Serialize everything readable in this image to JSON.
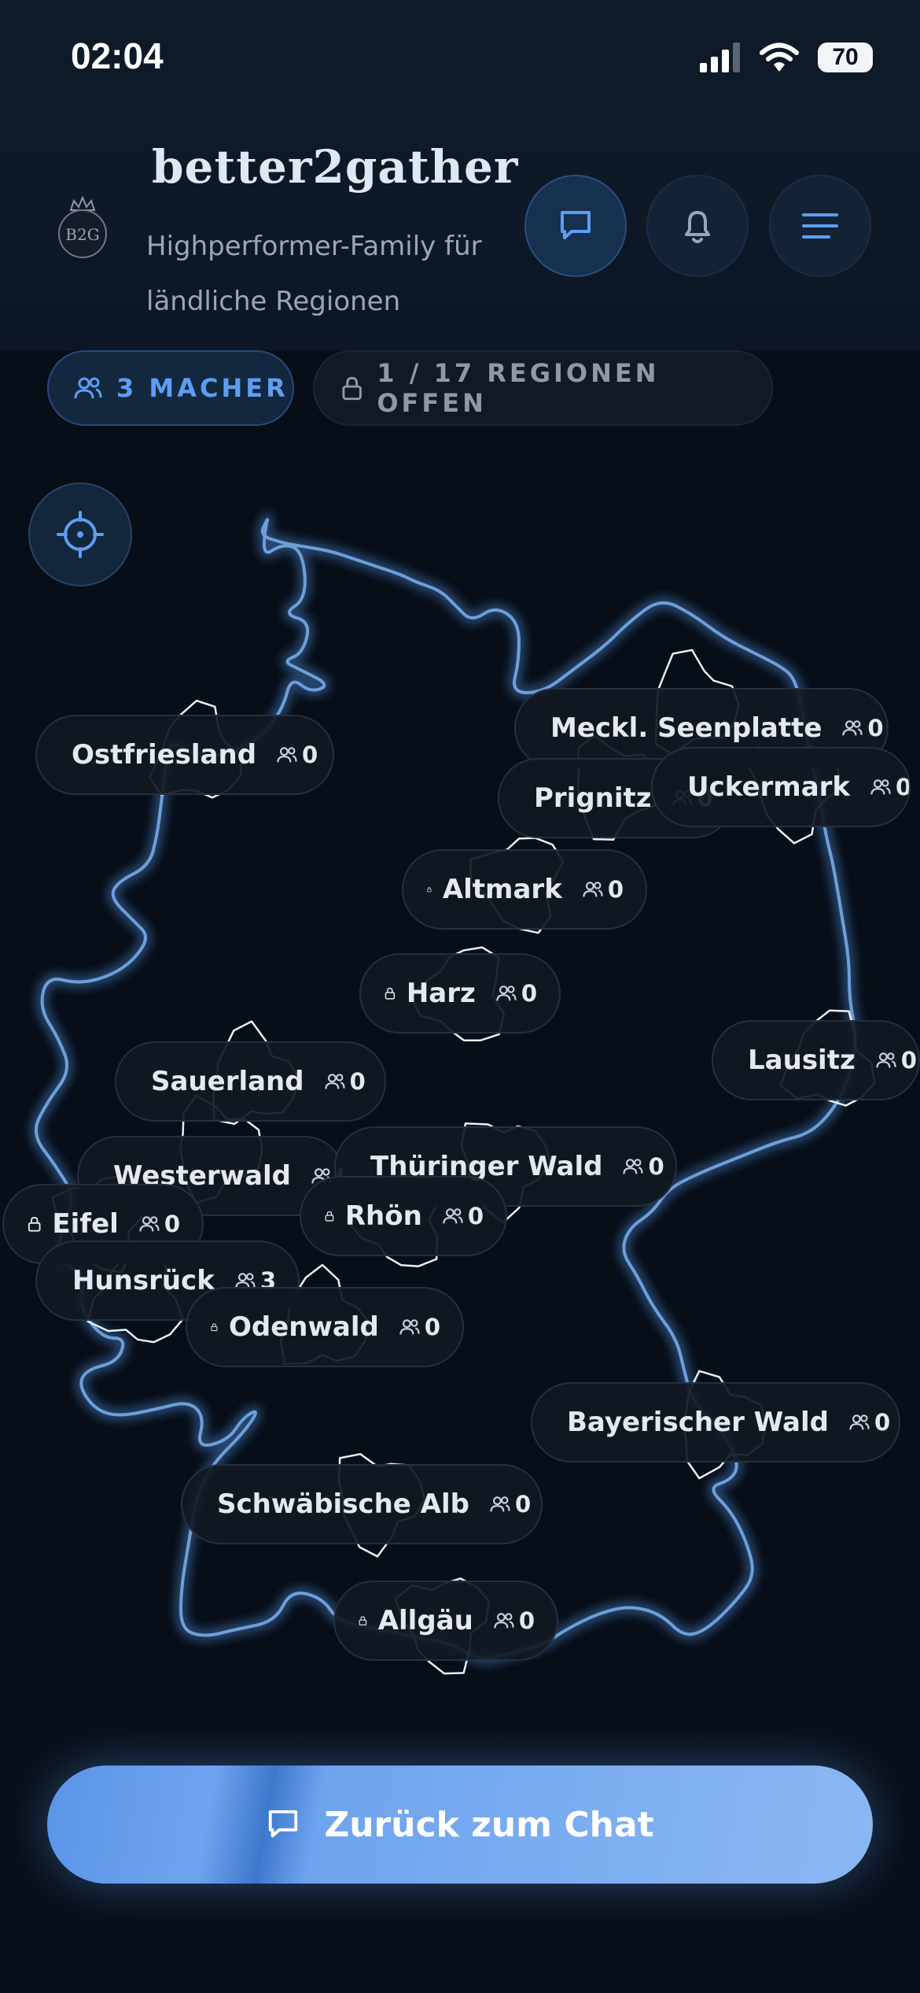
{
  "status_bar": {
    "time": "02:04",
    "battery": "70"
  },
  "header": {
    "logo_text": "B2G",
    "brand": "better2gather",
    "tagline": "Highperformer-Family für ländliche Regionen"
  },
  "stats": {
    "makers": "3 MACHER",
    "regions_open": "1 / 17 REGIONEN OFFEN"
  },
  "regions": [
    {
      "name": "Ostfriesland",
      "count": "0",
      "locked": true
    },
    {
      "name": "Meckl. Seenplatte",
      "count": "0",
      "locked": true
    },
    {
      "name": "Prignitz",
      "count": "0",
      "locked": true
    },
    {
      "name": "Uckermark",
      "count": "0",
      "locked": true
    },
    {
      "name": "Altmark",
      "count": "0",
      "locked": true
    },
    {
      "name": "Harz",
      "count": "0",
      "locked": true
    },
    {
      "name": "Lausitz",
      "count": "0",
      "locked": true
    },
    {
      "name": "Sauerland",
      "count": "0",
      "locked": true
    },
    {
      "name": "Westerwald",
      "count": "0",
      "locked": true
    },
    {
      "name": "Thüringer Wald",
      "count": "0",
      "locked": true
    },
    {
      "name": "Eifel",
      "count": "0",
      "locked": true
    },
    {
      "name": "Rhön",
      "count": "0",
      "locked": true
    },
    {
      "name": "Hunsrück",
      "count": "3",
      "locked": false
    },
    {
      "name": "Odenwald",
      "count": "0",
      "locked": true
    },
    {
      "name": "Bayerischer Wald",
      "count": "0",
      "locked": true
    },
    {
      "name": "Schwäbische Alb",
      "count": "0",
      "locked": true
    },
    {
      "name": "Allgäu",
      "count": "0",
      "locked": true
    }
  ],
  "cta": {
    "label": "Zurück zum Chat"
  },
  "colors": {
    "accent": "#5d9ef2",
    "background": "#080e17",
    "map_outline": "#6d9fd8"
  }
}
